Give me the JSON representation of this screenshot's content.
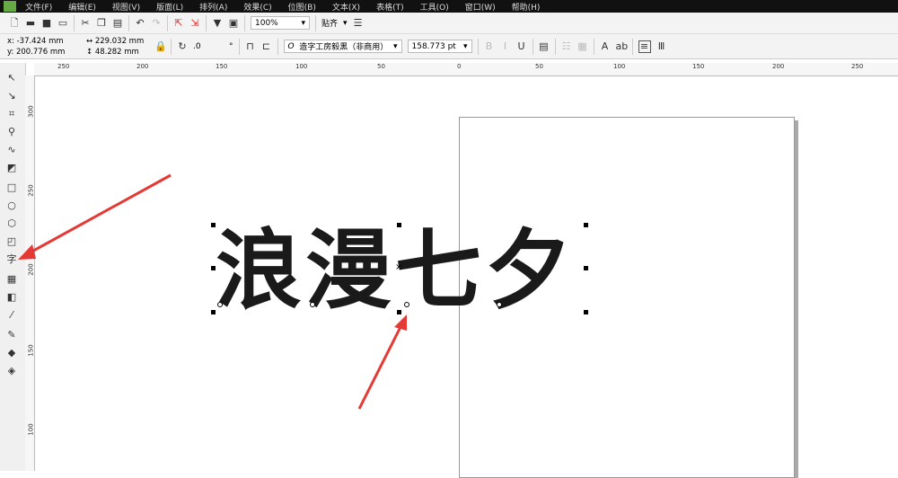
{
  "menu": [
    "文件(F)",
    "编辑(E)",
    "视图(V)",
    "版面(L)",
    "排列(A)",
    "效果(C)",
    "位图(B)",
    "文本(X)",
    "表格(T)",
    "工具(O)",
    "窗口(W)",
    "帮助(H)"
  ],
  "toolbar": {
    "zoom": "100%",
    "snap": "贴齐"
  },
  "property": {
    "x": "x: -37.424 mm",
    "y": "y: 200.776 mm",
    "w": "229.032 mm",
    "h": "48.282 mm",
    "angle": ".0",
    "angle_unit": "°",
    "font": "造字工房毅黑（非商用）",
    "font_size": "158.773 pt"
  },
  "ruler": {
    "h": [
      "250",
      "200",
      "150",
      "100",
      "50",
      "0",
      "50",
      "100",
      "150",
      "200",
      "250"
    ],
    "v": [
      "300",
      "250",
      "200",
      "150",
      "100"
    ]
  },
  "canvas": {
    "text": "浪漫七夕"
  },
  "colors": {
    "arrow": "#e53935"
  }
}
